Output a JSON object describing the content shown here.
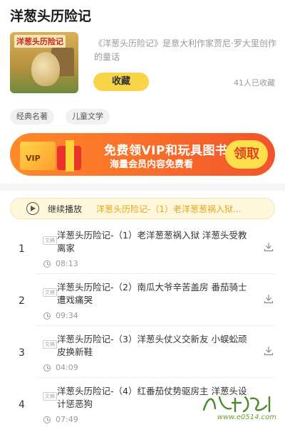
{
  "book": {
    "title": "洋葱头历险记",
    "cover_title": "洋葱头历险记",
    "description": "《洋葱头历险记》是意大利作家贾尼·罗大里创作的童话",
    "collect_label": "收藏",
    "collect_count": "41人已收藏",
    "tags": [
      "经典名著",
      "儿童文学"
    ]
  },
  "banner": {
    "headline": "免费领VIP和玩具图书",
    "subline": "海量会员内容免费看",
    "vip_text": "VIP",
    "cta": "领取"
  },
  "continue_play": {
    "label": "继续播放",
    "track": "洋葱头历险记-（1）老洋葱葱祸入狱..."
  },
  "episodes": [
    {
      "num": "1",
      "badge": "文稿",
      "title": "洋葱头历险记-（1）老洋葱葱祸入狱 洋葱头受教离家",
      "duration": "08:13"
    },
    {
      "num": "2",
      "badge": "文稿",
      "title": "洋葱头历险记-（2）南瓜大爷辛苦盖房 番茄骑士遭戏痛哭",
      "duration": "09:34"
    },
    {
      "num": "3",
      "badge": "文稿",
      "title": "洋葱头历险记-（3）洋葱头仗义交新友 小蜈蚣顽皮换新鞋",
      "duration": "04:09"
    },
    {
      "num": "4",
      "badge": "文稿",
      "title": "洋葱头历险记-（4）红番茄仗势驱房主 洋葱头设计惩恶狗",
      "duration": "07:49"
    }
  ],
  "watermark": {
    "site": "www.e0514.com"
  },
  "icons": {
    "play": "play-icon",
    "clock": "clock-icon",
    "download": "download-icon"
  },
  "colors": {
    "accent_yellow": "#f8d548",
    "track_orange": "#e3a41a",
    "banner_start": "#ff8a2a",
    "banner_end": "#f2542a"
  }
}
